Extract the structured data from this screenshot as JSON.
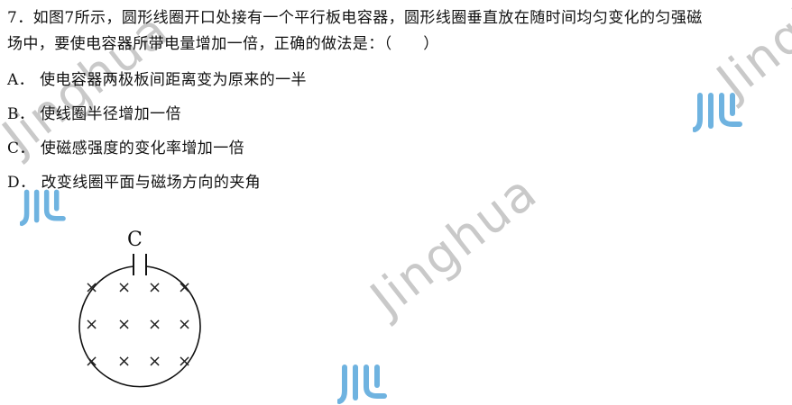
{
  "question": {
    "line1": "7．如图7所示，圆形线圈开口处接有一个平行板电容器，圆形线圈垂直放在随时间均匀变化的匀强磁",
    "line2": "场中，要使电容器所带电量增加一倍，正确的做法是：（　　）"
  },
  "options": [
    {
      "label": "A．",
      "text": "使电容器两极板间距离变为原来的一半"
    },
    {
      "label": "B．",
      "text": "使线圈半径增加一倍"
    },
    {
      "label": "C．",
      "text": "使磁感强度的变化率增加一倍"
    },
    {
      "label": "D．",
      "text": "改变线圈平面与磁场方向的夹角"
    }
  ],
  "figure": {
    "capacitor_label": "C",
    "cross_symbol": "×"
  },
  "watermark": {
    "text": "Jinghua",
    "color": "#c9c9c9",
    "logo_color": "#6fb3e0"
  }
}
